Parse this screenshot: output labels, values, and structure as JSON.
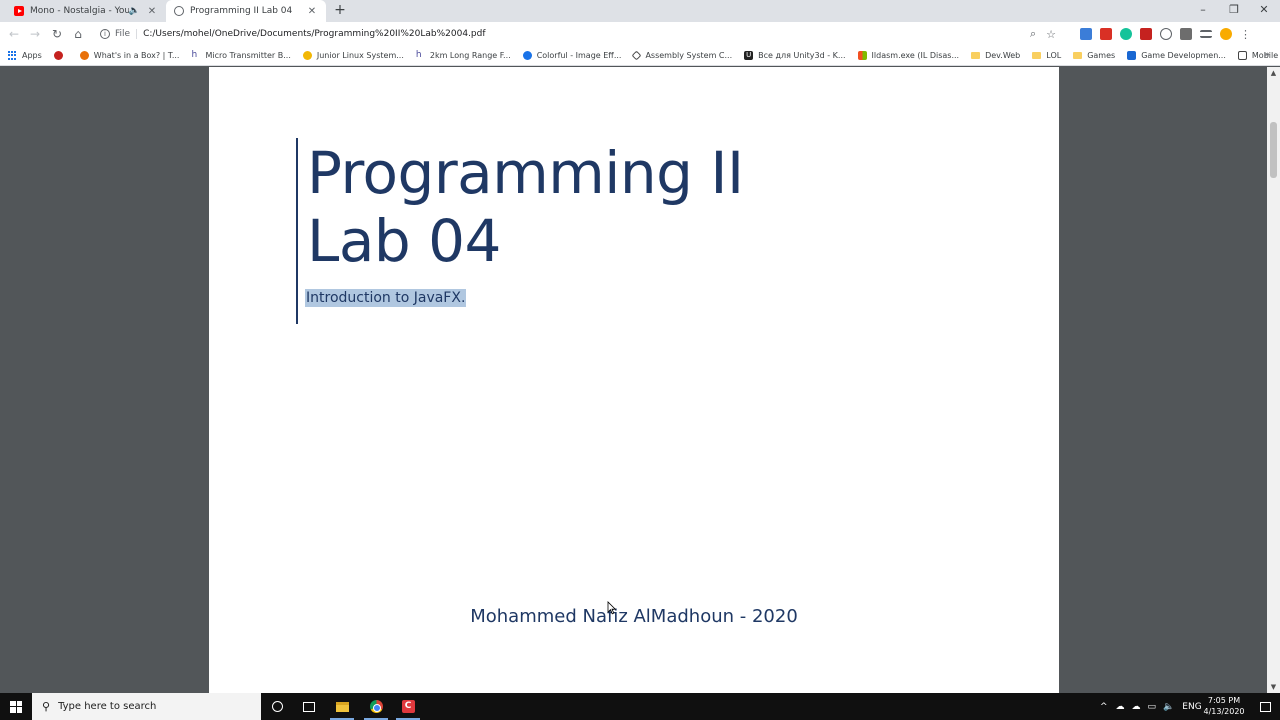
{
  "browser": {
    "tabs": [
      {
        "title": "Mono - Nostalgia - YouTube",
        "icon": "youtube-icon",
        "active": false
      },
      {
        "title": "Programming II Lab 04",
        "icon": "globe-icon",
        "active": true
      }
    ],
    "new_tab": "+",
    "window_controls": {
      "minimize": "–",
      "restore": "❐",
      "close": "✕"
    },
    "address": {
      "scheme_label": "File",
      "url": "C:/Users/mohel/OneDrive/Documents/Programming%20II%20Lab%2004.pdf"
    },
    "bookmarks": [
      {
        "label": "Apps",
        "icon": "apps-grid-icon"
      },
      {
        "label": "",
        "icon": "red-bookmark-icon"
      },
      {
        "label": "What's in a Box? | T...",
        "icon": "box-bookmark-icon"
      },
      {
        "label": "Micro Transmitter B...",
        "icon": "hackaday-icon"
      },
      {
        "label": "Junior Linux System...",
        "icon": "linux-icon"
      },
      {
        "label": "2km Long Range F...",
        "icon": "hackaday-icon"
      },
      {
        "label": "Colorful - Image Eff...",
        "icon": "colorful-icon"
      },
      {
        "label": "Assembly System C...",
        "icon": "unity-icon"
      },
      {
        "label": "Все для Unity3d - K...",
        "icon": "u-icon"
      },
      {
        "label": "Ildasm.exe (IL Disas...",
        "icon": "microsoft-icon"
      },
      {
        "label": "Dev.Web",
        "icon": "folder-icon"
      },
      {
        "label": "LOL",
        "icon": "folder-icon"
      },
      {
        "label": "Games",
        "icon": "folder-icon"
      },
      {
        "label": "Game Developmen...",
        "icon": "grid-bookmark-icon"
      },
      {
        "label": "Mobile Game GUI |...",
        "icon": "gui-bookmark-icon"
      }
    ],
    "bookmarks_more": "»"
  },
  "document": {
    "title_line1": "Programming II",
    "title_line2": "Lab 04",
    "subtitle": "Introduction to JavaFX.",
    "author": "Mohammed Nafiz AlMadhoun - 2020"
  },
  "taskbar": {
    "search_placeholder": "Type here to search",
    "language": "ENG",
    "time": "7:05 PM",
    "date": "4/13/2020"
  }
}
